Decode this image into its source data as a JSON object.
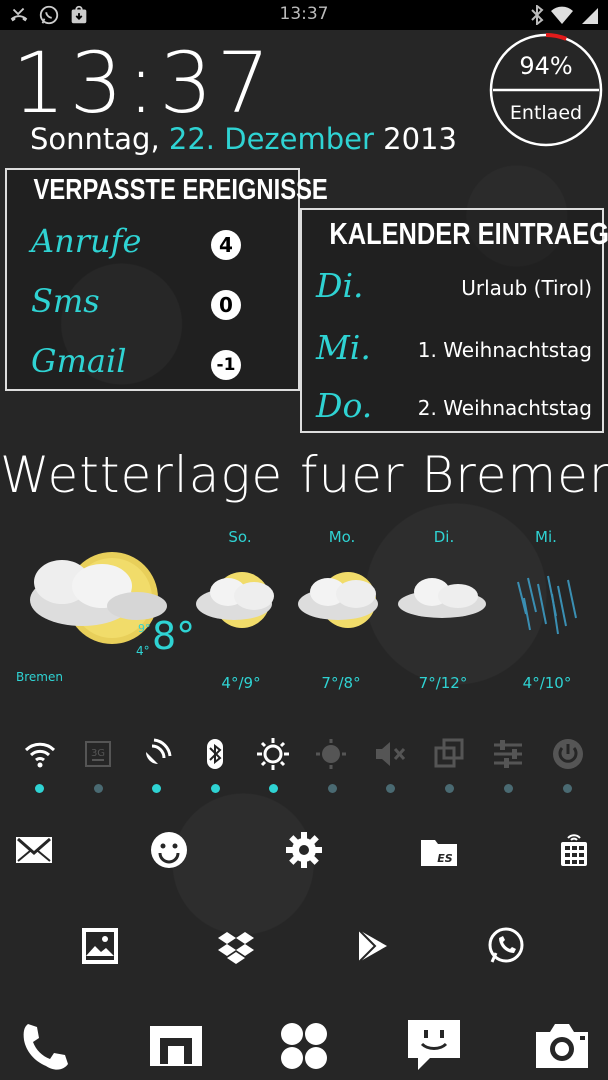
{
  "status_bar": {
    "time": "13:37",
    "left_icons": [
      "missed-call-icon",
      "whatsapp-icon",
      "download-bag-icon"
    ],
    "right_icons": [
      "bluetooth-icon",
      "wifi-icon",
      "signal-icon"
    ]
  },
  "clock": {
    "time": "13:37",
    "date_prefix": "Sonntag,",
    "date_day_month": "22. Dezember",
    "date_year": "2013"
  },
  "battery": {
    "percent_text": "94%",
    "percent_value": 94,
    "label": "Entlaed",
    "accent_color": "#e21b1b"
  },
  "missed_events": {
    "title": "VERPASSTE EREIGNISSE",
    "rows": [
      {
        "label": "Anrufe",
        "count": "4"
      },
      {
        "label": "Sms",
        "count": "0"
      },
      {
        "label": "Gmail",
        "count": "-1"
      }
    ]
  },
  "calendar": {
    "title": "KALENDER EINTRAEGE",
    "rows": [
      {
        "day": "Di.",
        "event": "Urlaub (Tirol)"
      },
      {
        "day": "Mi.",
        "event": "1. Weihnachtstag"
      },
      {
        "day": "Do.",
        "event": "2. Weihnachtstag"
      }
    ]
  },
  "weather": {
    "title": "Wetterlage fuer Bremen",
    "city": "Bremen",
    "current_temp": "8°",
    "current_high": "9°",
    "current_low": "4°",
    "forecast": [
      {
        "day": "So.",
        "temp": "4°/9°",
        "icon": "sun-cloud-icon"
      },
      {
        "day": "Mo.",
        "temp": "7°/8°",
        "icon": "sun-cloud-icon"
      },
      {
        "day": "Di.",
        "temp": "7°/12°",
        "icon": "cloud-icon"
      },
      {
        "day": "Mi.",
        "temp": "4°/10°",
        "icon": "rain-icon"
      }
    ]
  },
  "toggles": [
    {
      "icon": "wifi-icon",
      "active": true
    },
    {
      "icon": "mobile-data-3g-icon",
      "active": false
    },
    {
      "icon": "gps-icon",
      "active": true
    },
    {
      "icon": "bluetooth-icon",
      "active": true
    },
    {
      "icon": "auto-brightness-icon",
      "active": true
    },
    {
      "icon": "brightness-icon",
      "active": false
    },
    {
      "icon": "mute-icon",
      "active": false
    },
    {
      "icon": "screen-rotate-icon",
      "active": false
    },
    {
      "icon": "settings-sliders-icon",
      "active": false
    },
    {
      "icon": "power-icon",
      "active": false
    }
  ],
  "colors": {
    "accent": "#2fd3d3",
    "inactive": "#4a6a72",
    "text": "#ffffff"
  },
  "apps_row1": [
    "mail-icon",
    "smiley-icon",
    "settings-gear-icon",
    "file-explorer-icon",
    "sim-toolkit-icon"
  ],
  "apps_row2": [
    "gallery-icon",
    "dropbox-icon",
    "play-store-icon",
    "whatsapp-icon"
  ],
  "dock": [
    "phone-icon",
    "browser-icon",
    "app-drawer-icon",
    "messaging-icon",
    "camera-icon"
  ]
}
